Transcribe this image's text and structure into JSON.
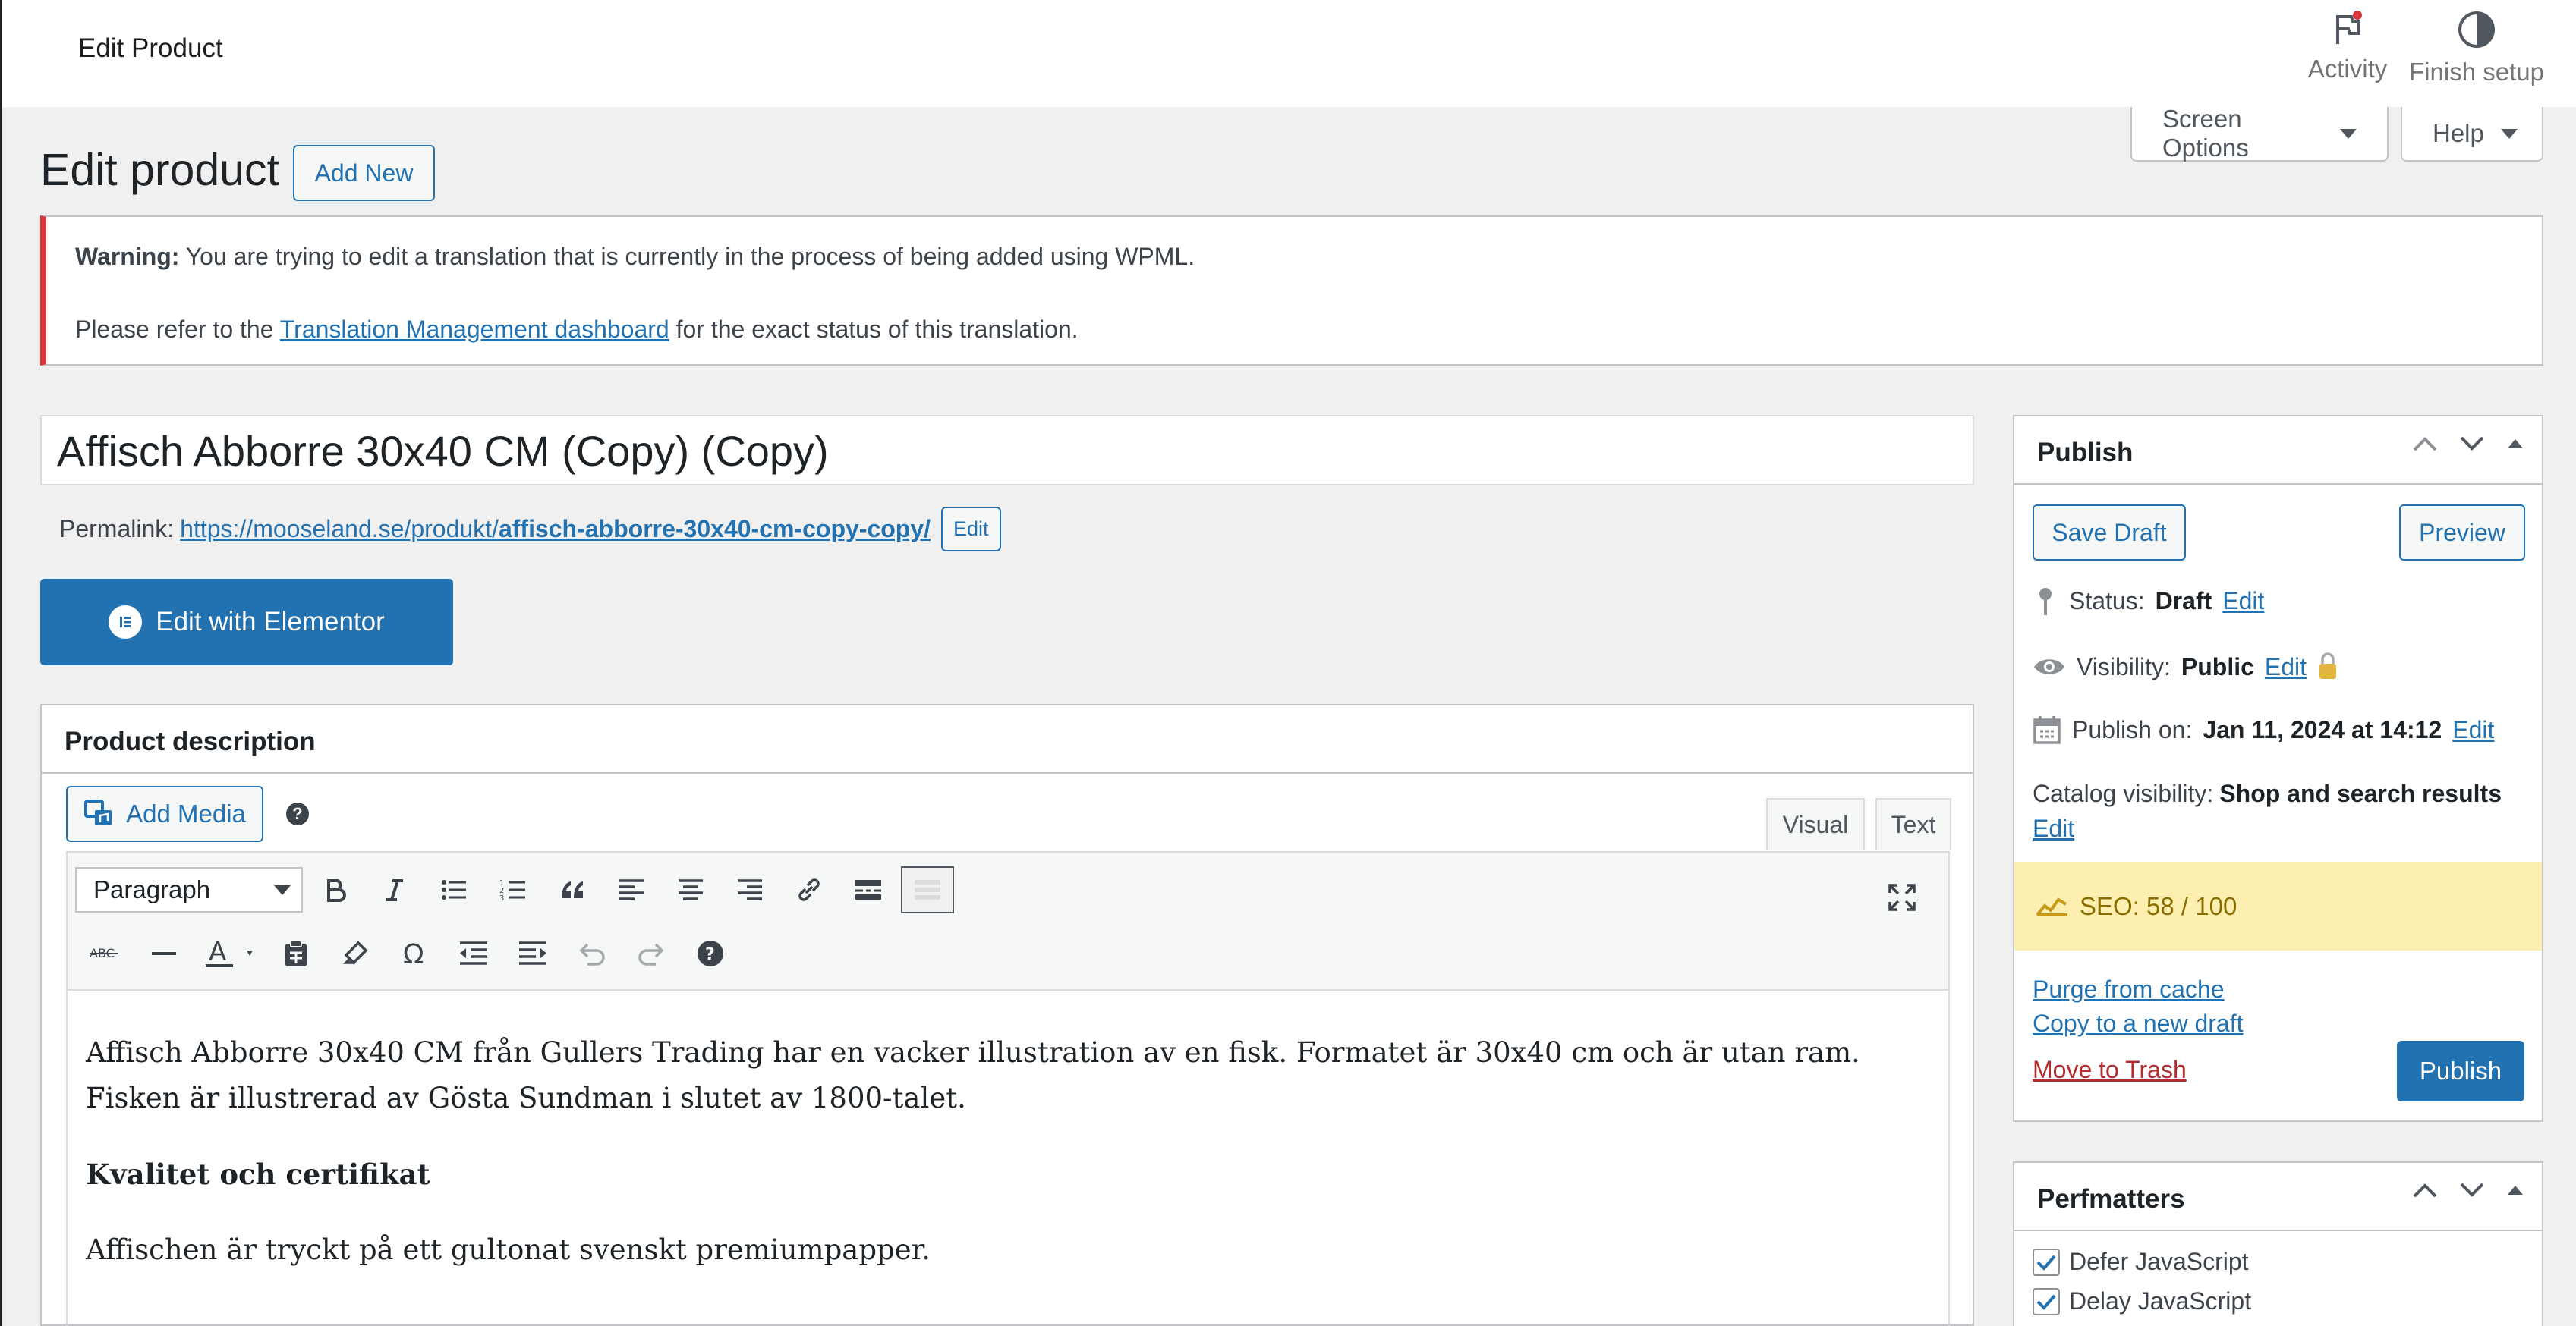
{
  "topbar": {
    "title": "Edit Product",
    "activity_label": "Activity",
    "finish_label": "Finish setup"
  },
  "screen_options": {
    "screen_options_label": "Screen Options",
    "help_label": "Help"
  },
  "heading": {
    "title": "Edit product",
    "add_new_label": "Add New"
  },
  "notice": {
    "warning_label": "Warning:",
    "warning_text": " You are trying to edit a translation that is currently in the process of being added using WPML.",
    "refer_prefix": "Please refer to the ",
    "link_text": "Translation Management dashboard",
    "refer_suffix": " for the exact status of this translation."
  },
  "post": {
    "title": "Affisch Abborre 30x40 CM (Copy) (Copy)",
    "permalink_label": "Permalink:",
    "permalink_base": "https://mooseland.se/produkt/",
    "permalink_slug": "affisch-abborre-30x40-cm-copy-copy/",
    "permalink_edit": "Edit",
    "elementor_label": "Edit with Elementor"
  },
  "description": {
    "box_title": "Product description",
    "add_media_label": "Add Media",
    "help_symbol": "?",
    "tab_visual": "Visual",
    "tab_text": "Text",
    "format_value": "Paragraph",
    "content": {
      "p1": "Affisch Abborre 30x40 CM från Gullers Trading har en vacker illustration av en fisk. Formatet är 30x40 cm och är utan ram. Fisken är illustrerad av Gösta Sundman i slutet av 1800-talet.",
      "h1": "Kvalitet och certifikat",
      "p2": "Affischen är tryckt på ett gultonat svenskt premiumpapper."
    }
  },
  "toolbar_icons": {
    "row1": [
      "bold-icon",
      "italic-icon",
      "bullet-list-icon",
      "numbered-list-icon",
      "blockquote-icon",
      "align-left-icon",
      "align-center-icon",
      "align-right-icon",
      "link-icon",
      "read-more-icon",
      "toolbar-toggle-icon"
    ],
    "row2": [
      "strikethrough-icon",
      "horizontal-line-icon",
      "text-color-icon",
      "paste-text-icon",
      "clear-formatting-icon",
      "special-character-icon",
      "outdent-icon",
      "indent-icon",
      "undo-icon",
      "redo-icon",
      "keyboard-help-icon"
    ]
  },
  "publish": {
    "title": "Publish",
    "save_draft": "Save Draft",
    "preview": "Preview",
    "status_label": "Status:",
    "status_value": "Draft",
    "visibility_label": "Visibility:",
    "visibility_value": "Public",
    "publish_on_label": "Publish on:",
    "publish_on_value": "Jan 11, 2024 at 14:12",
    "catalog_label": "Catalog visibility:",
    "catalog_value": "Shop and search results",
    "edit": "Edit",
    "seo": "SEO: 58 / 100",
    "purge": "Purge from cache",
    "copy_draft": "Copy to a new draft",
    "trash": "Move to Trash",
    "publish_btn": "Publish"
  },
  "perfmatters": {
    "title": "Perfmatters",
    "items": [
      "Defer JavaScript",
      "Delay JavaScript"
    ]
  },
  "colors": {
    "accent": "#2271b1",
    "error": "#d63638",
    "seo_bg": "#fcefb0"
  }
}
